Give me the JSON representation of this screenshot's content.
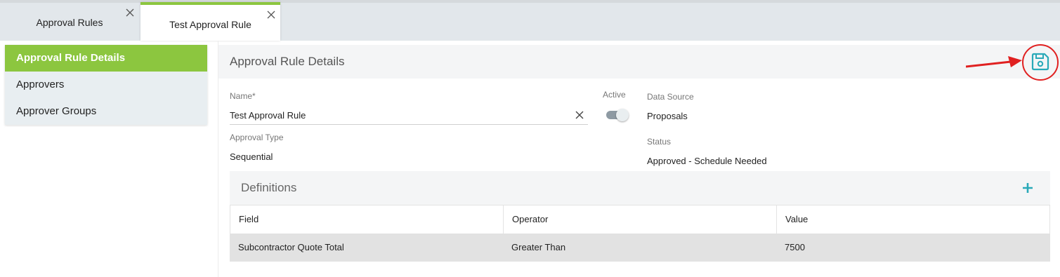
{
  "tabs": [
    {
      "label": "Approval Rules",
      "active": false
    },
    {
      "label": "Test Approval Rule",
      "active": true
    }
  ],
  "sidebar": {
    "items": [
      {
        "label": "Approval Rule Details",
        "active": true
      },
      {
        "label": "Approvers",
        "active": false
      },
      {
        "label": "Approver Groups",
        "active": false
      }
    ]
  },
  "panel": {
    "title": "Approval Rule Details"
  },
  "form": {
    "name_label": "Name*",
    "name_value": "Test Approval Rule",
    "active_label": "Active",
    "active_on": true,
    "approval_type_label": "Approval Type",
    "approval_type_value": "Sequential",
    "data_source_label": "Data Source",
    "data_source_value": "Proposals",
    "status_label": "Status",
    "status_value": "Approved - Schedule Needed"
  },
  "definitions": {
    "title": "Definitions",
    "columns": [
      "Field",
      "Operator",
      "Value"
    ],
    "rows": [
      [
        "Subcontractor Quote Total",
        "Greater Than",
        "7500"
      ]
    ]
  },
  "colors": {
    "accent_green": "#8cc63f",
    "teal_icon": "#29a9b8",
    "annotation_red": "#e02020"
  },
  "icons": {
    "tab_close": "close-icon",
    "save": "save-icon",
    "clear": "clear-icon",
    "add": "plus-icon"
  }
}
